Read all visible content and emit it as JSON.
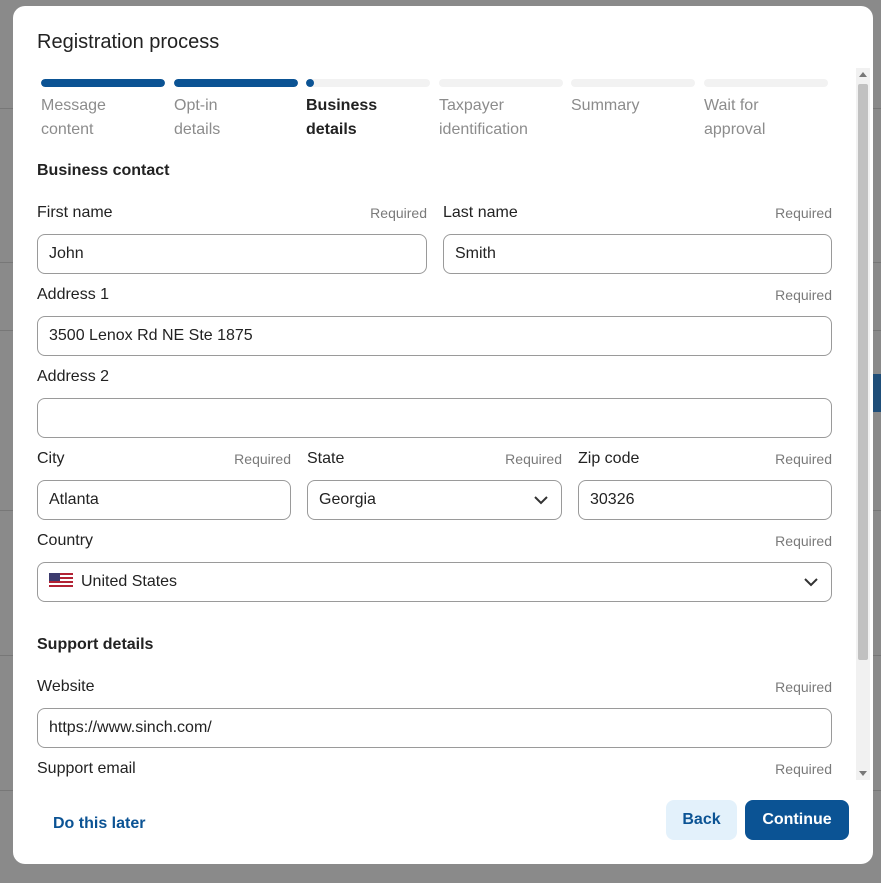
{
  "modal": {
    "title": "Registration process"
  },
  "stepper": {
    "steps": [
      {
        "line1": "Message",
        "line2": "content",
        "status": "done",
        "progress": 1.0
      },
      {
        "line1": "Opt-in",
        "line2": "details",
        "status": "done",
        "progress": 1.0
      },
      {
        "line1": "Business",
        "line2": "details",
        "status": "active",
        "progress": 0.06
      },
      {
        "line1": "Taxpayer",
        "line2": "identification",
        "status": "pending",
        "progress": 0
      },
      {
        "line1": "Summary",
        "line2": "",
        "status": "pending",
        "progress": 0
      },
      {
        "line1": "Wait for",
        "line2": "approval",
        "status": "pending",
        "progress": 0
      }
    ]
  },
  "business_contact": {
    "title": "Business contact",
    "first_name": {
      "label": "First name",
      "required": "Required",
      "value": "John"
    },
    "last_name": {
      "label": "Last name",
      "required": "Required",
      "value": "Smith"
    },
    "address1": {
      "label": "Address 1",
      "required": "Required",
      "value": "3500 Lenox Rd NE Ste 1875"
    },
    "address2": {
      "label": "Address 2",
      "value": ""
    },
    "city": {
      "label": "City",
      "required": "Required",
      "value": "Atlanta"
    },
    "state": {
      "label": "State",
      "required": "Required",
      "value": "Georgia"
    },
    "zip": {
      "label": "Zip code",
      "required": "Required",
      "value": "30326"
    },
    "country": {
      "label": "Country",
      "required": "Required",
      "value": "United States"
    }
  },
  "support_details": {
    "title": "Support details",
    "website": {
      "label": "Website",
      "required": "Required",
      "value": "https://www.sinch.com/"
    },
    "support_email": {
      "label": "Support email",
      "required": "Required"
    }
  },
  "footer": {
    "later_label": "Do this later",
    "back_label": "Back",
    "continue_label": "Continue"
  },
  "colors": {
    "accent": "#0b5394",
    "back_bg": "#e3f1fb"
  }
}
